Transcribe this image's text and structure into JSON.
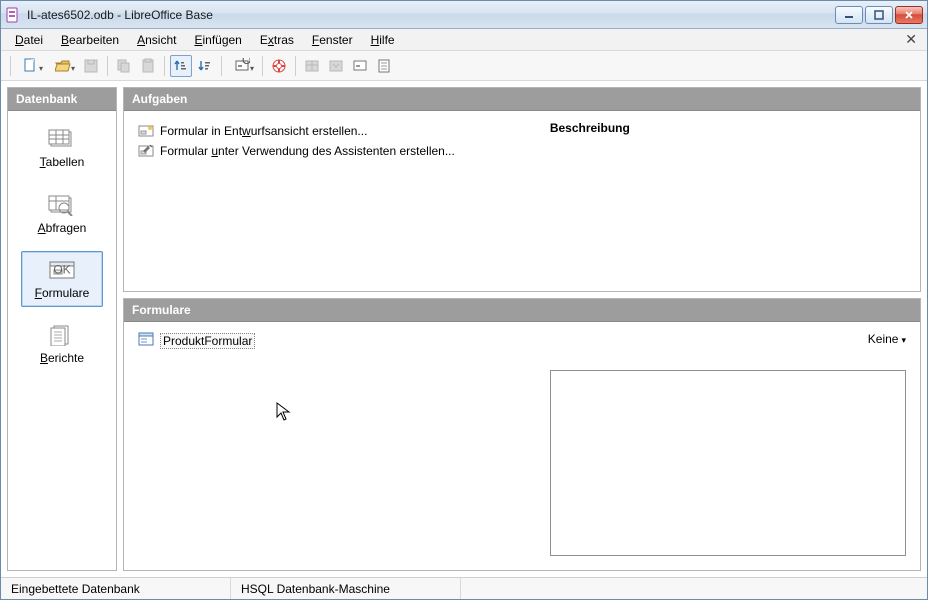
{
  "window": {
    "title": "IL-ates6502.odb - LibreOffice Base"
  },
  "menu": {
    "datei": "Datei",
    "bearbeiten": "Bearbeiten",
    "ansicht": "Ansicht",
    "einfuegen": "Einfügen",
    "extras": "Extras",
    "fenster": "Fenster",
    "hilfe": "Hilfe"
  },
  "sidebar": {
    "header": "Datenbank",
    "items": [
      {
        "label": "Tabellen",
        "ul": "T",
        "rest": "abellen"
      },
      {
        "label": "Abfragen",
        "ul": "A",
        "rest": "bfragen"
      },
      {
        "label": "Formulare",
        "ul": "F",
        "rest": "ormulare"
      },
      {
        "label": "Berichte",
        "ul": "B",
        "rest": "erichte"
      }
    ]
  },
  "tasks": {
    "header": "Aufgaben",
    "items": [
      {
        "pre": "Formular in Ent",
        "ul": "w",
        "post": "urfsansicht erstellen..."
      },
      {
        "pre": "Formular ",
        "ul": "u",
        "post": "nter Verwendung des Assistenten erstellen..."
      }
    ],
    "desc_title": "Beschreibung"
  },
  "list": {
    "header": "Formulare",
    "items": [
      "ProduktFormular"
    ],
    "preview_mode": "Keine"
  },
  "status": {
    "left": "Eingebettete Datenbank",
    "mid": "HSQL Datenbank-Maschine"
  }
}
